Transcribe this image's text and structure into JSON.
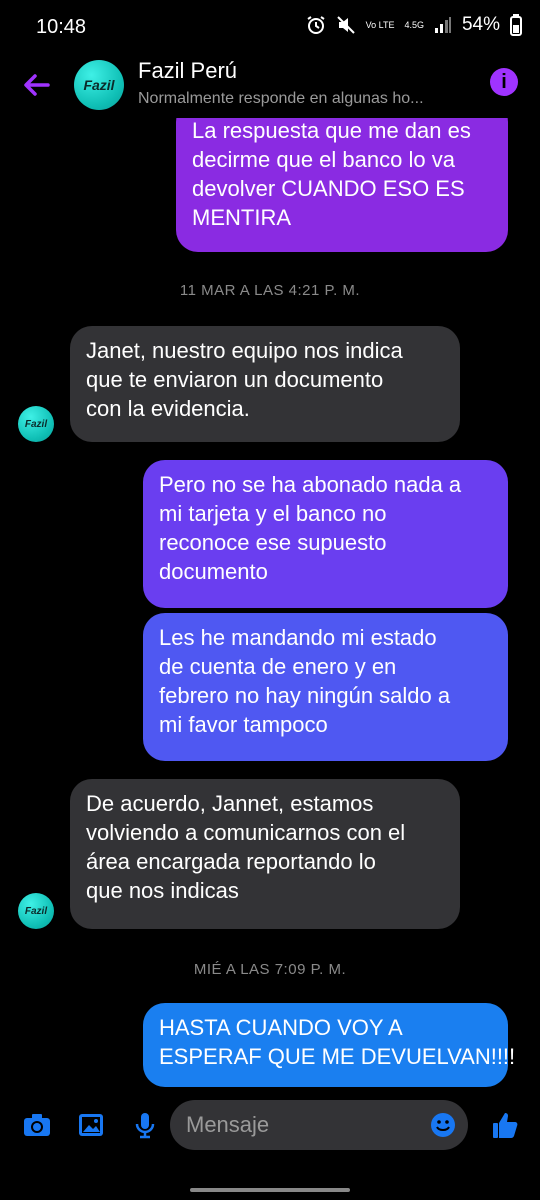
{
  "status": {
    "time": "10:48",
    "network": "4.5G",
    "lte": "Vo LTE",
    "battery": "54%"
  },
  "header": {
    "name": "Fazil Perú",
    "subtitle": "Normalmente responde en algunas ho...",
    "avatar_text": "Fazil"
  },
  "messages": [
    {
      "type": "sent",
      "lines": [
        "La respuesta que me dan es",
        "decirme que el banco lo va",
        "devolver CUANDO ESO ES",
        "MENTIRA"
      ],
      "color": "#8a2be2"
    },
    {
      "type": "timestamp",
      "text": "11 MAR A LAS 4:21 P. M."
    },
    {
      "type": "received",
      "lines": [
        "Janet, nuestro equipo nos indica",
        "que te enviaron un documento",
        "con la evidencia."
      ]
    },
    {
      "type": "sent",
      "lines": [
        "Pero no se ha abonado nada a",
        "mi tarjeta y el banco no",
        "reconoce ese supuesto",
        "documento"
      ],
      "color": "#6a3ef0"
    },
    {
      "type": "sent",
      "lines": [
        "Les he mandando mi estado",
        "de cuenta de enero y en",
        "febrero no hay ningún saldo a",
        "mi favor tampoco"
      ],
      "color": "#4f58f2"
    },
    {
      "type": "received",
      "lines": [
        "De acuerdo, Jannet, estamos",
        "volviendo a comunicarnos con el",
        "área encargada reportando lo",
        "que nos indicas"
      ]
    },
    {
      "type": "timestamp",
      "text": "MIÉ A LAS 7:09 P. M."
    },
    {
      "type": "sent",
      "lines": [
        "HASTA CUANDO VOY A",
        "ESPERAF QUE ME DEVUELVAN!!!!"
      ],
      "color": "#1a7ff0"
    }
  ],
  "composer": {
    "placeholder": "Mensaje"
  },
  "icons": [
    "back-arrow-icon",
    "info-icon",
    "camera-icon",
    "image-icon",
    "microphone-icon",
    "emoji-icon",
    "thumbs-up-icon"
  ],
  "colors": {
    "accent": "#a033ff",
    "messenger_blue": "#1877f2",
    "received_bubble": "#333336"
  }
}
